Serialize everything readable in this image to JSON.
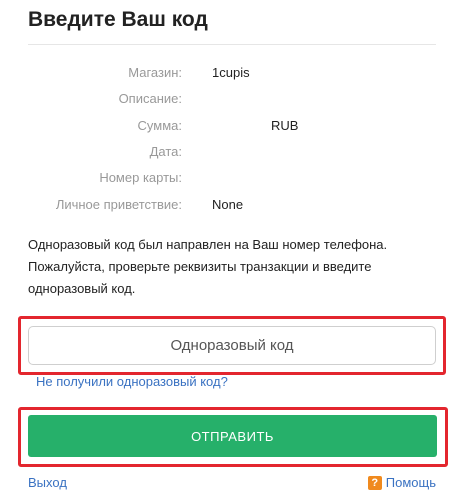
{
  "page": {
    "title": "Введите Ваш код"
  },
  "details": [
    {
      "label": "Магазин:",
      "value": "1cupis"
    },
    {
      "label": "Описание:",
      "value": ""
    },
    {
      "label": "Сумма:",
      "value": "RUB"
    },
    {
      "label": "Дата:",
      "value": ""
    },
    {
      "label": "Номер карты:",
      "value": ""
    },
    {
      "label": "Личное приветствие:",
      "value": "None"
    }
  ],
  "info": {
    "text": "Одноразовый код был направлен на Ваш номер телефона. Пожалуйста, проверьте реквизиты транзакции и введите одноразовый код."
  },
  "form": {
    "otp_placeholder": "Одноразовый код",
    "resend_link": "Не получили одноразовый код?",
    "submit_label": "ОТПРАВИТЬ"
  },
  "footer": {
    "exit_link": "Выход",
    "help_icon_glyph": "?",
    "help_link": "Помощь"
  },
  "colors": {
    "submit_green": "#26b06a",
    "highlight_red": "#e3262e",
    "link_blue": "#3a72c2",
    "help_orange": "#f08a1e"
  }
}
